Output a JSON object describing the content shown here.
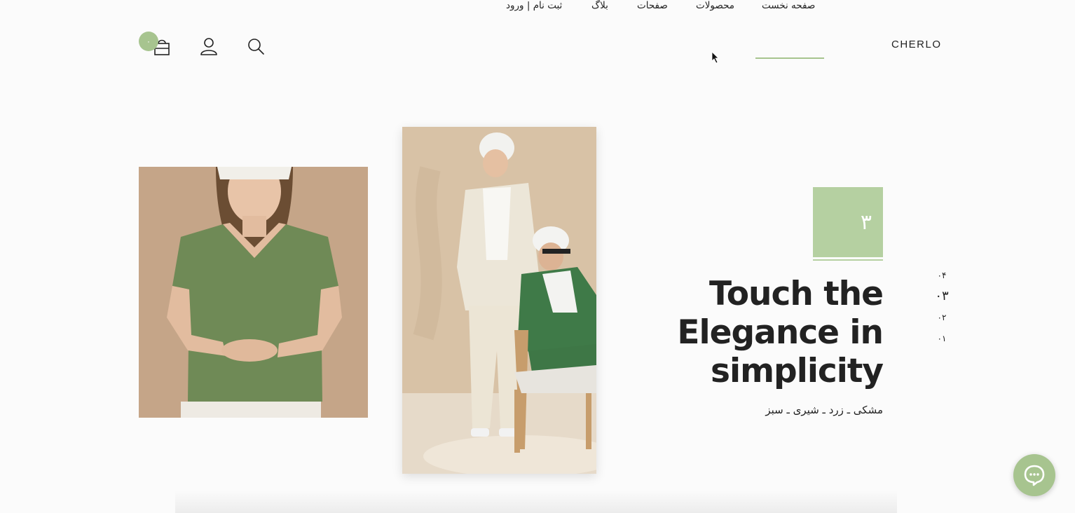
{
  "brand": {
    "logo": "CHERLO"
  },
  "nav": {
    "home": "صفحه نخست",
    "products": "محصولات",
    "pages": "صفحات",
    "blog": "بلاگ",
    "signup": "ثبت نام | ورود"
  },
  "header_icons": {
    "search": "search-icon",
    "user": "user-icon",
    "cart": "cart-icon"
  },
  "cart": {
    "count": "۰"
  },
  "slide": {
    "number": "۳",
    "headline": "Touch the Elegance in simplicity",
    "colors": "مشکی ـ زرد ـ شیری ـ سبز"
  },
  "pagination": [
    "۰۴",
    "۰۳",
    "۰۲",
    "۰۱"
  ],
  "pagination_active": "۰۳",
  "accent_color": "#a7c48f",
  "chat": {
    "icon": "chat-bubble-icon"
  }
}
